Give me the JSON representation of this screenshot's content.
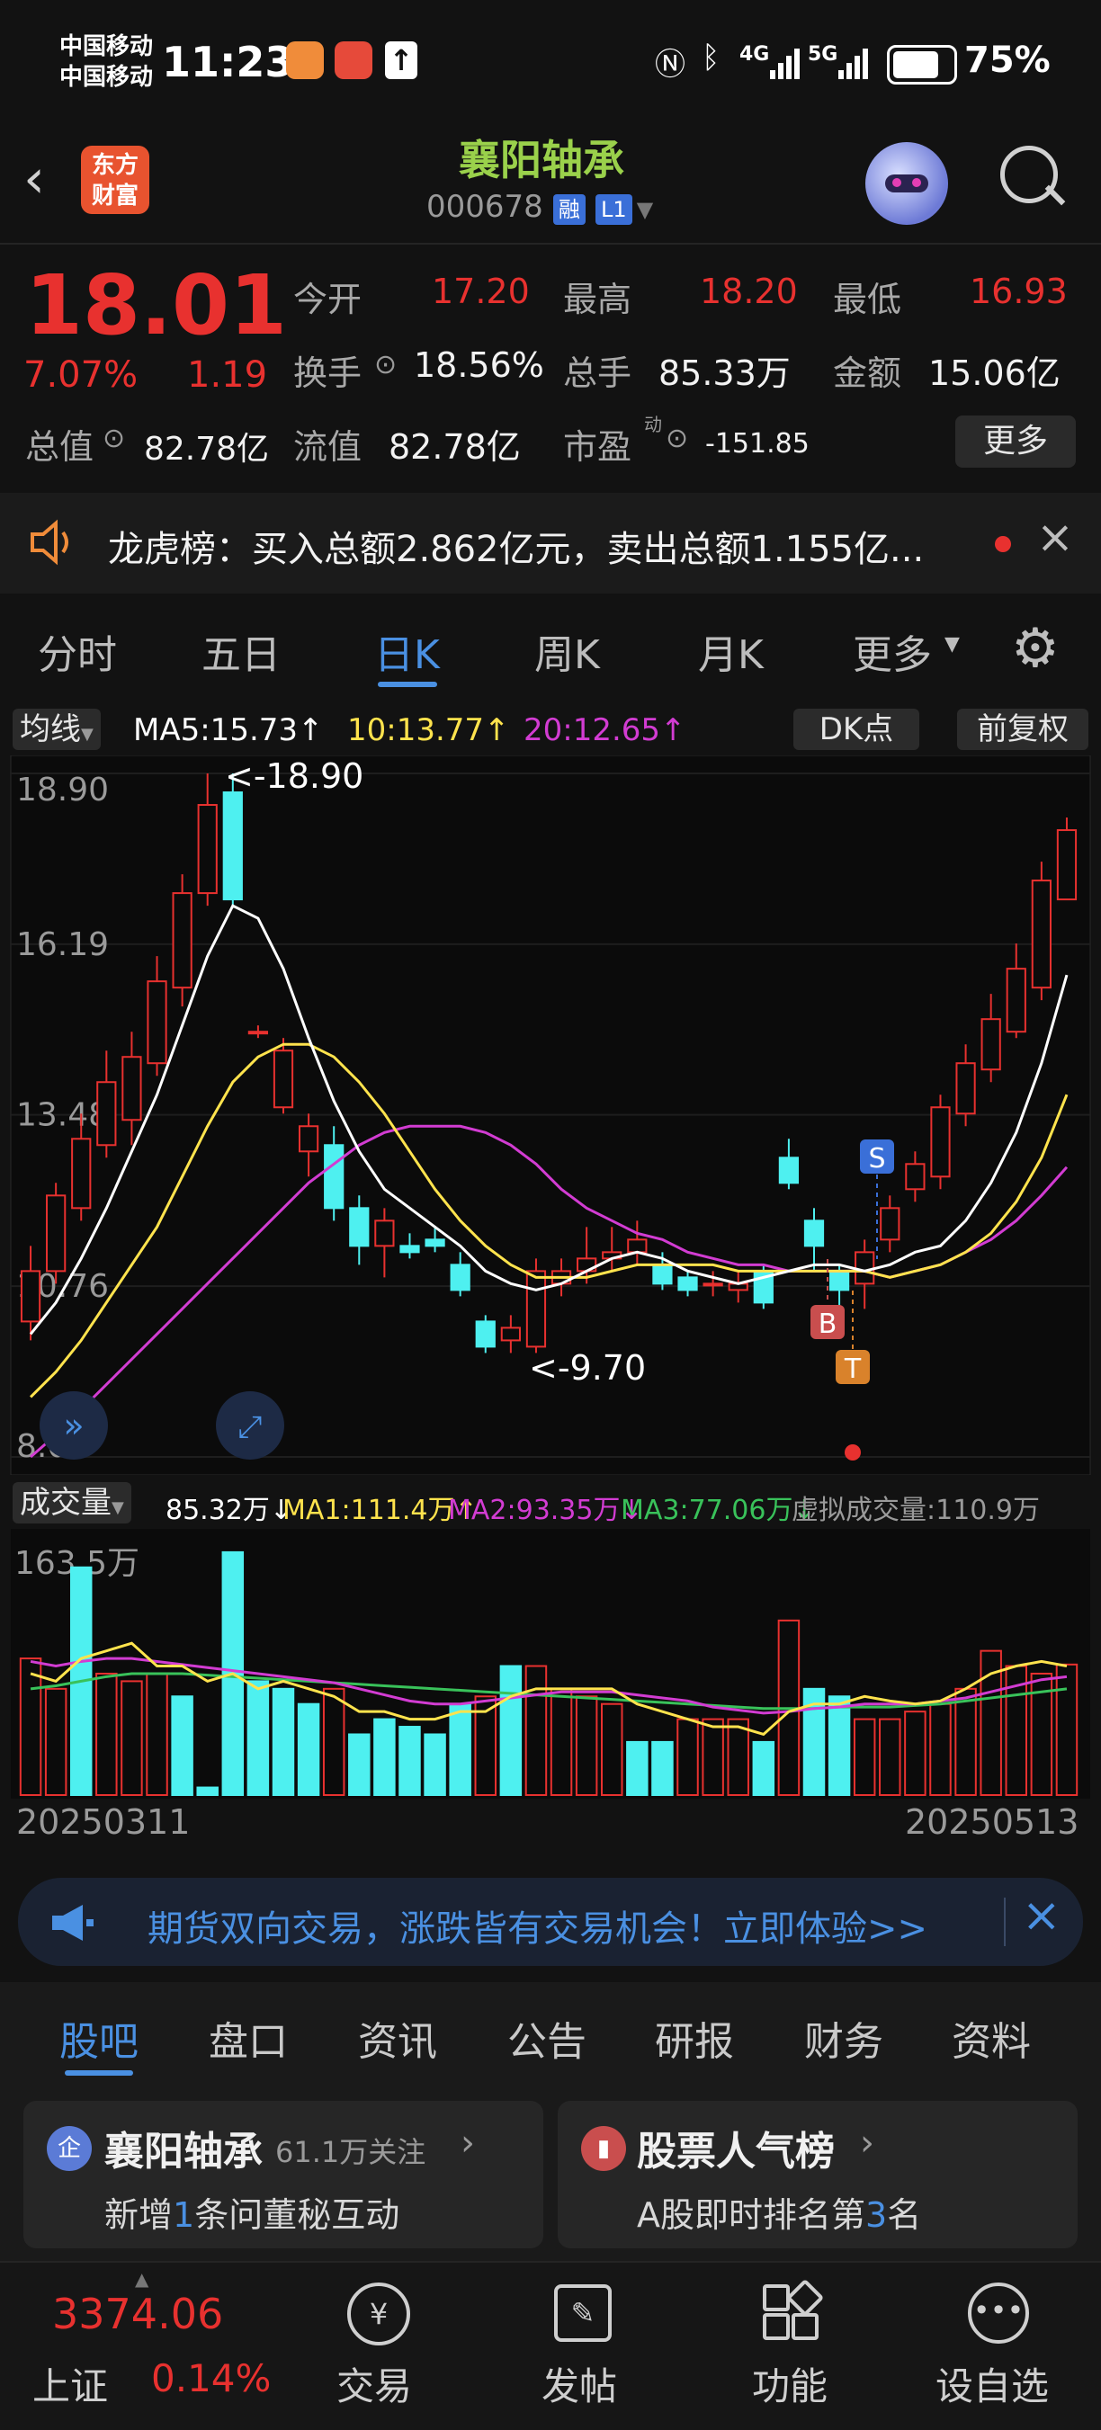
{
  "status_bar": {
    "carrier1": "中国移动",
    "carrier2": "中国移动",
    "time": "11:23",
    "network": "4G",
    "network2": "5G",
    "battery": "75%"
  },
  "header": {
    "logo_line1": "东方",
    "logo_line2": "财富",
    "stock_name": "襄阳轴承",
    "stock_code": "000678",
    "badge_margin": "融",
    "badge_level": "L1"
  },
  "quote": {
    "price": "18.01",
    "change_pct": "7.07%",
    "change_amt": "1.19",
    "open_label": "今开",
    "open": "17.20",
    "high_label": "最高",
    "high": "18.20",
    "low_label": "最低",
    "low": "16.93",
    "turnover_label": "换手",
    "turnover": "18.56%",
    "volume_label": "总手",
    "volume": "85.33万",
    "amount_label": "金额",
    "amount": "15.06亿",
    "mktcap_label": "总值",
    "mktcap": "82.78亿",
    "float_label": "流值",
    "float": "82.78亿",
    "pe_label": "市盈",
    "pe_sup": "动",
    "pe": "-151.85",
    "more_button": "更多"
  },
  "notice": {
    "text": "龙虎榜：买入总额2.862亿元，卖出总额1.155亿..."
  },
  "period_tabs": [
    "分时",
    "五日",
    "日K",
    "周K",
    "月K",
    "更多"
  ],
  "active_period": "日K",
  "chart_header": {
    "indicator": "均线",
    "ma5": "MA5:15.73↑",
    "ma10": "10:13.77↑",
    "ma20": "20:12.65↑",
    "dk_button": "DK点",
    "adjust_button": "前复权"
  },
  "chart_data": {
    "type": "candlestick",
    "y_ticks": [
      "18.90",
      "16.19",
      "13.48",
      "10.76",
      "8.05"
    ],
    "ylim": [
      8.05,
      18.9
    ],
    "max_label": "<-18.90",
    "min_label": "<-9.70",
    "marks": [
      "S",
      "B",
      "T"
    ],
    "x_start": "20250311",
    "x_end": "20250513",
    "candles": [
      {
        "o": 10.2,
        "c": 11.0,
        "h": 11.4,
        "l": 9.9,
        "up": true
      },
      {
        "o": 11.0,
        "c": 12.2,
        "h": 12.4,
        "l": 10.8,
        "up": true
      },
      {
        "o": 12.0,
        "c": 13.1,
        "h": 13.5,
        "l": 11.8,
        "up": true
      },
      {
        "o": 13.0,
        "c": 14.0,
        "h": 14.5,
        "l": 12.8,
        "up": true
      },
      {
        "o": 13.4,
        "c": 14.4,
        "h": 14.8,
        "l": 13.0,
        "up": true
      },
      {
        "o": 14.3,
        "c": 15.6,
        "h": 16.0,
        "l": 14.1,
        "up": true
      },
      {
        "o": 15.5,
        "c": 17.0,
        "h": 17.3,
        "l": 15.2,
        "up": true
      },
      {
        "o": 17.0,
        "c": 18.4,
        "h": 18.9,
        "l": 16.8,
        "up": true
      },
      {
        "o": 18.6,
        "c": 16.9,
        "h": 18.9,
        "l": 16.8,
        "up": false
      },
      {
        "o": 14.8,
        "c": 14.8,
        "h": 14.9,
        "l": 14.7,
        "up": true
      },
      {
        "o": 13.6,
        "c": 14.5,
        "h": 14.7,
        "l": 13.5,
        "up": true
      },
      {
        "o": 12.9,
        "c": 13.3,
        "h": 13.5,
        "l": 12.5,
        "up": true
      },
      {
        "o": 13.0,
        "c": 12.0,
        "h": 13.3,
        "l": 11.8,
        "up": false
      },
      {
        "o": 12.0,
        "c": 11.4,
        "h": 12.2,
        "l": 11.1,
        "up": false
      },
      {
        "o": 11.4,
        "c": 11.8,
        "h": 12.0,
        "l": 10.9,
        "up": true
      },
      {
        "o": 11.4,
        "c": 11.3,
        "h": 11.6,
        "l": 11.2,
        "up": false
      },
      {
        "o": 11.5,
        "c": 11.4,
        "h": 11.7,
        "l": 11.3,
        "up": false
      },
      {
        "o": 11.1,
        "c": 10.7,
        "h": 11.3,
        "l": 10.6,
        "up": false
      },
      {
        "o": 10.2,
        "c": 9.8,
        "h": 10.3,
        "l": 9.7,
        "up": false
      },
      {
        "o": 9.9,
        "c": 10.1,
        "h": 10.3,
        "l": 9.7,
        "up": true
      },
      {
        "o": 9.8,
        "c": 11.0,
        "h": 11.2,
        "l": 9.7,
        "up": true
      },
      {
        "o": 10.8,
        "c": 11.0,
        "h": 11.2,
        "l": 10.6,
        "up": true
      },
      {
        "o": 11.0,
        "c": 11.2,
        "h": 11.7,
        "l": 10.8,
        "up": true
      },
      {
        "o": 11.2,
        "c": 11.3,
        "h": 11.7,
        "l": 11.0,
        "up": true
      },
      {
        "o": 11.3,
        "c": 11.5,
        "h": 11.8,
        "l": 11.1,
        "up": true
      },
      {
        "o": 11.1,
        "c": 10.8,
        "h": 11.3,
        "l": 10.7,
        "up": false
      },
      {
        "o": 10.9,
        "c": 10.7,
        "h": 11.0,
        "l": 10.6,
        "up": false
      },
      {
        "o": 10.8,
        "c": 10.8,
        "h": 11.0,
        "l": 10.6,
        "up": true
      },
      {
        "o": 10.7,
        "c": 10.8,
        "h": 11.0,
        "l": 10.5,
        "up": true
      },
      {
        "o": 11.0,
        "c": 10.5,
        "h": 11.1,
        "l": 10.4,
        "up": false
      },
      {
        "o": 12.8,
        "c": 12.4,
        "h": 13.1,
        "l": 12.3,
        "up": false
      },
      {
        "o": 11.8,
        "c": 11.4,
        "h": 12.0,
        "l": 11.0,
        "up": false
      },
      {
        "o": 11.0,
        "c": 10.7,
        "h": 11.1,
        "l": 10.2,
        "up": false
      },
      {
        "o": 10.8,
        "c": 11.3,
        "h": 11.5,
        "l": 10.4,
        "up": true
      },
      {
        "o": 11.5,
        "c": 12.0,
        "h": 12.2,
        "l": 11.3,
        "up": true
      },
      {
        "o": 12.3,
        "c": 12.7,
        "h": 12.9,
        "l": 12.1,
        "up": true
      },
      {
        "o": 12.5,
        "c": 13.6,
        "h": 13.8,
        "l": 12.3,
        "up": true
      },
      {
        "o": 13.5,
        "c": 14.3,
        "h": 14.6,
        "l": 13.3,
        "up": true
      },
      {
        "o": 14.2,
        "c": 15.0,
        "h": 15.4,
        "l": 14.0,
        "up": true
      },
      {
        "o": 14.8,
        "c": 15.8,
        "h": 16.2,
        "l": 14.7,
        "up": true
      },
      {
        "o": 15.5,
        "c": 17.2,
        "h": 17.5,
        "l": 15.3,
        "up": true
      },
      {
        "o": 16.9,
        "c": 18.0,
        "h": 18.2,
        "l": 16.9,
        "up": true
      }
    ],
    "ma5": [
      10.0,
      10.5,
      11.2,
      12.0,
      12.9,
      13.8,
      14.9,
      16.0,
      16.8,
      16.6,
      15.8,
      14.7,
      13.7,
      12.9,
      12.3,
      12.0,
      11.7,
      11.4,
      11.0,
      10.8,
      10.7,
      10.8,
      11.0,
      11.2,
      11.3,
      11.2,
      11.0,
      10.9,
      10.8,
      10.9,
      11.0,
      11.1,
      11.1,
      11.0,
      11.1,
      11.3,
      11.4,
      11.8,
      12.4,
      13.2,
      14.3,
      15.7
    ],
    "ma10": [
      9.0,
      9.4,
      9.9,
      10.5,
      11.1,
      11.7,
      12.5,
      13.3,
      14.0,
      14.4,
      14.6,
      14.6,
      14.4,
      14.0,
      13.5,
      12.9,
      12.3,
      11.8,
      11.4,
      11.1,
      10.9,
      10.9,
      10.9,
      11.0,
      11.1,
      11.1,
      11.1,
      11.1,
      11.0,
      11.0,
      11.0,
      11.0,
      11.0,
      11.0,
      10.9,
      11.0,
      11.1,
      11.3,
      11.6,
      12.1,
      12.8,
      13.8
    ],
    "ma20": [
      8.05,
      8.4,
      8.8,
      9.2,
      9.6,
      10.0,
      10.4,
      10.8,
      11.2,
      11.6,
      12.0,
      12.4,
      12.7,
      13.0,
      13.2,
      13.3,
      13.3,
      13.3,
      13.2,
      13.0,
      12.7,
      12.3,
      12.0,
      11.8,
      11.6,
      11.5,
      11.3,
      11.2,
      11.1,
      11.1,
      11.0,
      11.0,
      11.0,
      11.0,
      10.9,
      11.0,
      11.1,
      11.3,
      11.5,
      11.8,
      12.2,
      12.65
    ]
  },
  "volume_header": {
    "label": "成交量",
    "vol": "85.32万↓",
    "ma1": "MA1:111.4万↑",
    "ma2": "MA2:93.35万↓",
    "ma3": "MA3:77.06万↓",
    "virtual": "虚拟成交量:110.9万",
    "y_top": "163.5万"
  },
  "volume_data": {
    "bars": [
      90,
      70,
      150,
      80,
      75,
      80,
      65,
      5,
      160,
      75,
      70,
      60,
      70,
      40,
      50,
      45,
      40,
      60,
      65,
      85,
      85,
      70,
      65,
      60,
      35,
      35,
      50,
      50,
      50,
      35,
      115,
      70,
      65,
      50,
      50,
      55,
      60,
      70,
      95,
      85,
      80,
      86
    ],
    "up": [
      true,
      true,
      false,
      true,
      true,
      true,
      false,
      false,
      false,
      false,
      false,
      false,
      true,
      false,
      false,
      false,
      false,
      false,
      true,
      false,
      true,
      true,
      true,
      true,
      false,
      false,
      true,
      true,
      true,
      false,
      true,
      false,
      false,
      true,
      true,
      true,
      true,
      true,
      true,
      true,
      true,
      true
    ],
    "ma1": [
      80,
      75,
      90,
      95,
      100,
      85,
      85,
      75,
      80,
      70,
      75,
      70,
      65,
      55,
      55,
      50,
      50,
      55,
      55,
      65,
      70,
      70,
      70,
      70,
      60,
      55,
      50,
      45,
      45,
      40,
      55,
      60,
      60,
      65,
      62,
      60,
      62,
      70,
      80,
      85,
      88,
      85
    ],
    "ma2": [
      88,
      85,
      88,
      90,
      90,
      88,
      86,
      84,
      82,
      80,
      78,
      76,
      74,
      70,
      66,
      62,
      60,
      60,
      62,
      64,
      66,
      68,
      68,
      68,
      66,
      64,
      62,
      58,
      56,
      54,
      55,
      57,
      58,
      60,
      60,
      60,
      62,
      64,
      68,
      72,
      76,
      78
    ],
    "ma3": [
      70,
      72,
      75,
      78,
      80,
      80,
      80,
      79,
      78,
      77,
      76,
      75,
      74,
      73,
      72,
      71,
      70,
      69,
      68,
      67,
      66,
      65,
      64,
      63,
      62,
      61,
      60,
      59,
      58,
      57,
      57,
      57,
      58,
      58,
      58,
      59,
      60,
      62,
      64,
      66,
      68,
      70
    ]
  },
  "promo": {
    "text": "期货双向交易，涨跌皆有交易机会！立即体验>>"
  },
  "bottom_tabs": [
    "股吧",
    "盘口",
    "资讯",
    "公告",
    "研报",
    "财务",
    "资料"
  ],
  "active_bottom_tab": "股吧",
  "cards": {
    "left_title": "襄阳轴承",
    "left_follow": "61.1万关注",
    "left_sub_pre": "新增",
    "left_sub_num": "1",
    "left_sub_post": "条问董秘互动",
    "right_title": "股票人气榜",
    "right_sub_pre": "A股即时排名第",
    "right_sub_num": "3",
    "right_sub_post": "名"
  },
  "bottom_nav": {
    "index_value": "3374.06",
    "index_name": "上证",
    "index_change": "0.14%",
    "trade": "交易",
    "post": "发帖",
    "function": "功能",
    "watch": "设自选"
  },
  "colors": {
    "up": "#e8312f",
    "down": "#4ef0f0",
    "ma5": "#ffffff",
    "ma10": "#ffe34d",
    "ma20": "#d23cd2",
    "accent": "#4a90e2",
    "title": "#9ad14b"
  }
}
